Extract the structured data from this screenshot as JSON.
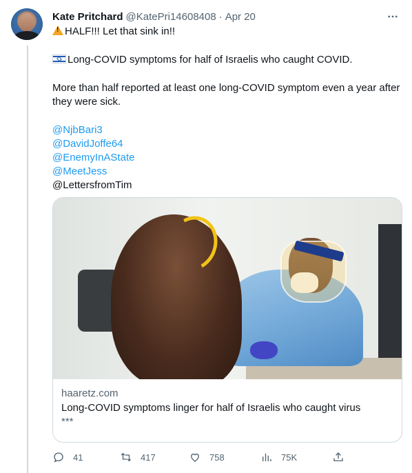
{
  "tweet": {
    "author_name": "Kate Pritchard",
    "author_handle": "@KatePri14608408",
    "separator": "·",
    "date": "Apr 20",
    "line1": "HALF!!! Let that sink in!!",
    "line2": "Long-COVID symptoms for half of Israelis who caught COVID.",
    "line3": "More than half reported at least one long-COVID symptom even a year after they were sick.",
    "mentions": [
      "@NjbBari3",
      "@DavidJoffe64",
      "@EnemyInAState",
      "@MeetJess"
    ],
    "last_mention": "@LettersfromTim",
    "icons": {
      "warning": "warning-icon",
      "flag": "israel-flag-icon",
      "more": "more-icon"
    }
  },
  "card": {
    "domain": "haaretz.com",
    "title": "Long-COVID symptoms linger for half of Israelis who caught virus",
    "description": "***"
  },
  "actions": {
    "replies": "41",
    "retweets": "417",
    "likes": "758",
    "views": "75K"
  },
  "colors": {
    "link": "#1d9bf0",
    "text": "#0f1419",
    "muted": "#536471",
    "border": "#cfd9de"
  }
}
